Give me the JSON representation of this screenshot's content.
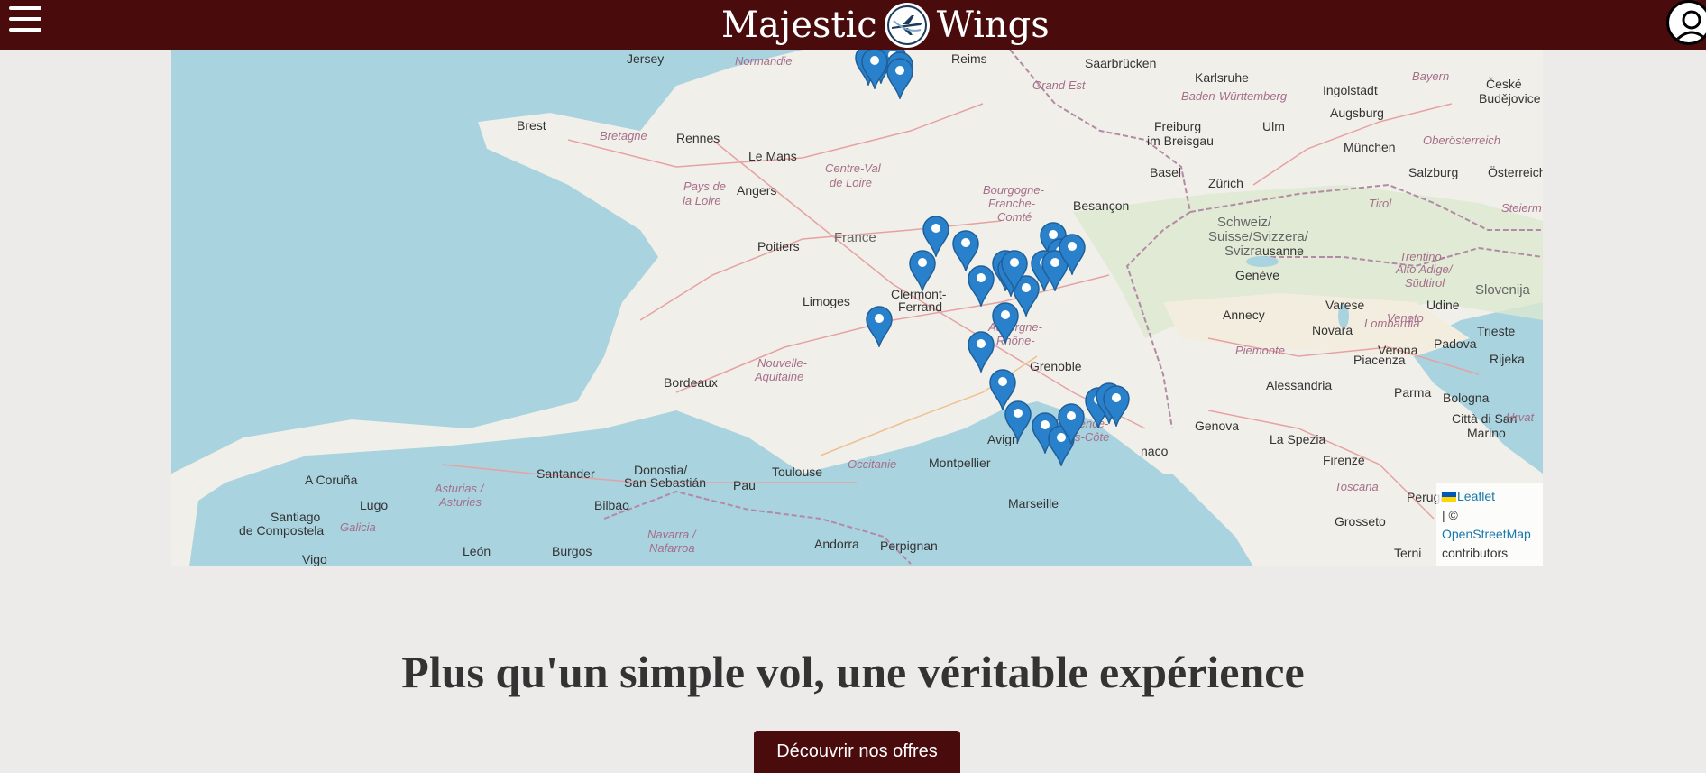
{
  "header": {
    "brand_left": "Majestic",
    "brand_right": "Wings",
    "colors": {
      "bar": "#4a0b0d",
      "text": "#ffffff"
    },
    "icons": {
      "menu": "hamburger-menu-icon",
      "logo": "airplane-emblem-icon",
      "account": "user-account-icon"
    }
  },
  "map": {
    "places": {
      "jersey": "Jersey",
      "normandie": "Normandie",
      "reims": "Reims",
      "saarbrucken": "Saarbrücken",
      "brest": "Brest",
      "bretagne": "Bretagne",
      "rennes": "Rennes",
      "grand_est": "Grand Est",
      "karlsruhe": "Karlsruhe",
      "ingolstadt": "Ingolstadt",
      "bayern": "Bayern",
      "ceske": "České",
      "budejovice": "Budějovice",
      "badenw": "Baden-Württemberg",
      "augsburg": "Augsburg",
      "lemans": "Le Mans",
      "centre_val": "Centre-Val",
      "de_loire": "de Loire",
      "pays": "Pays de",
      "la_loire": "la Loire",
      "angers": "Angers",
      "freiburg": "Freiburg",
      "im_breisgau": "im Breisgau",
      "ulm": "Ulm",
      "munchen": "München",
      "oberosterreich": "Oberösterreich",
      "bourgogne": "Bourgogne-",
      "franche": "Franche-",
      "comte": "Comté",
      "basel": "Basel",
      "zurich": "Zürich",
      "salzburg": "Salzburg",
      "osterreich": "Österreich",
      "france": "France",
      "besancon": "Besançon",
      "tirol": "Tirol",
      "steiermark": "Steierm",
      "schweiz": "Schweiz/",
      "suisse": "Suisse/Svizzera/",
      "svizra": "Svizra",
      "poitiers": "Poitiers",
      "lausanne": "usanne",
      "trentino": "Trentino-",
      "alto_adige": "Alto Adige/",
      "sudtirol": "Südtirol",
      "clermont": "Clermont-",
      "ferrand": "Ferrand",
      "limoges": "Limoges",
      "geneve": "Genève",
      "annecy": "Annecy",
      "varese": "Varese",
      "udine": "Udine",
      "slovenija": "Slovenija",
      "veneto": "Veneto",
      "novara": "Novara",
      "lombardia": "Lombardia",
      "trieste": "Trieste",
      "auvergne": "Auvergne-",
      "rhone": "Rhône-",
      "nouvelle": "Nouvelle-",
      "aquitaine": "Aquitaine",
      "piemonte": "Piemonte",
      "verona": "Verona",
      "padova": "Padova",
      "rijeka": "Rijeka",
      "bordeaux": "Bordeaux",
      "grenoble": "Grenoble",
      "piacenza": "Piacenza",
      "alessandria": "Alessandria",
      "parma": "Parma",
      "bologna": "Bologna",
      "citta": "Città di San",
      "marino": "Marino",
      "hrvat": "Hrvat",
      "genova": "Genova",
      "provence": "Provence-",
      "alpes": "Alpes-Côte",
      "avignon": "Avign",
      "la_spezia": "La Spezia",
      "monaco": "naco",
      "a_coruna": "A Coruña",
      "santander": "Santander",
      "donostia": "Donostia/",
      "san_sebastian": "San Sebastián",
      "toulouse": "Toulouse",
      "occitanie": "Occitanie",
      "montpellier": "Montpellier",
      "firenze": "Firenze",
      "asturias": "Asturias /",
      "asturies": "Asturies",
      "lugo": "Lugo",
      "bilbao": "Bilbao",
      "pau": "Pau",
      "marseille": "Marseille",
      "toscana": "Toscana",
      "perugia": "Perugia",
      "santiago": "Santiago",
      "de_compostela": "de Compostela",
      "galicia": "Galicia",
      "navarra": "Navarra /",
      "nafarroa": "Nafarroa",
      "grosseto": "Grosseto",
      "leon": "León",
      "burgos": "Burgos",
      "andorra": "Andorra",
      "perpignan": "Perpignan",
      "terni": "Terni",
      "vigo": "Vigo"
    },
    "marker_count": 30,
    "attribution": {
      "leaflet": "Leaflet",
      "separator": "| ©",
      "osm": "OpenStreetMap",
      "contributors": "contributors"
    },
    "colors": {
      "sea": "#a9d3df",
      "land": "#f1efe9",
      "marker": "#2a81cb"
    }
  },
  "hero": {
    "headline": "Plus qu'un simple vol, une véritable expérience",
    "cta_label": "Découvrir nos offres"
  }
}
